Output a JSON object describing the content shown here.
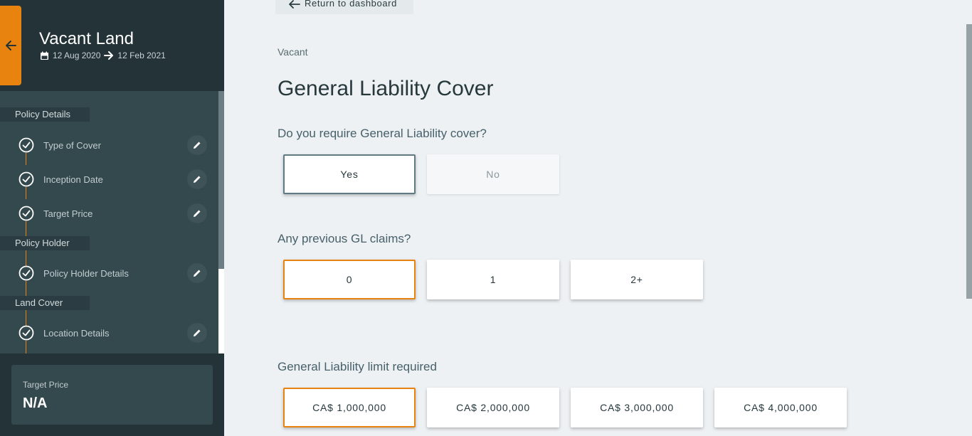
{
  "sidebar": {
    "title": "Vacant Land",
    "start_date": "12 Aug 2020",
    "end_date": "12 Feb 2021",
    "sections": [
      {
        "label": "Policy Details"
      },
      {
        "label": "Policy Holder"
      },
      {
        "label": "Land Cover"
      }
    ],
    "steps": [
      {
        "label": "Type of Cover"
      },
      {
        "label": "Inception Date"
      },
      {
        "label": "Target Price"
      },
      {
        "label": "Policy Holder Details"
      },
      {
        "label": "Location Details"
      }
    ],
    "footer": {
      "label": "Target Price",
      "value": "N/A"
    }
  },
  "main": {
    "return_label": "Return to dashboard",
    "breadcrumb": "Vacant",
    "title": "General Liability Cover",
    "q1": {
      "label": "Do you require General Liability cover?",
      "options": [
        "Yes",
        "No"
      ],
      "selected": "Yes"
    },
    "q2": {
      "label": "Any previous GL claims?",
      "options": [
        "0",
        "1",
        "2+"
      ],
      "selected": "0"
    },
    "q3": {
      "label": "General Liability limit required",
      "options": [
        "CA$ 1,000,000",
        "CA$ 2,000,000",
        "CA$ 3,000,000",
        "CA$ 4,000,000"
      ],
      "selected": "CA$ 1,000,000"
    }
  },
  "colors": {
    "accent": "#e8830f",
    "sidebar_bg": "#2b3c40",
    "page_bg": "#edf1f3"
  },
  "icons": [
    "arrow-left-icon",
    "calendar-icon",
    "arrow-right-icon",
    "check-circle-icon",
    "pencil-icon"
  ]
}
